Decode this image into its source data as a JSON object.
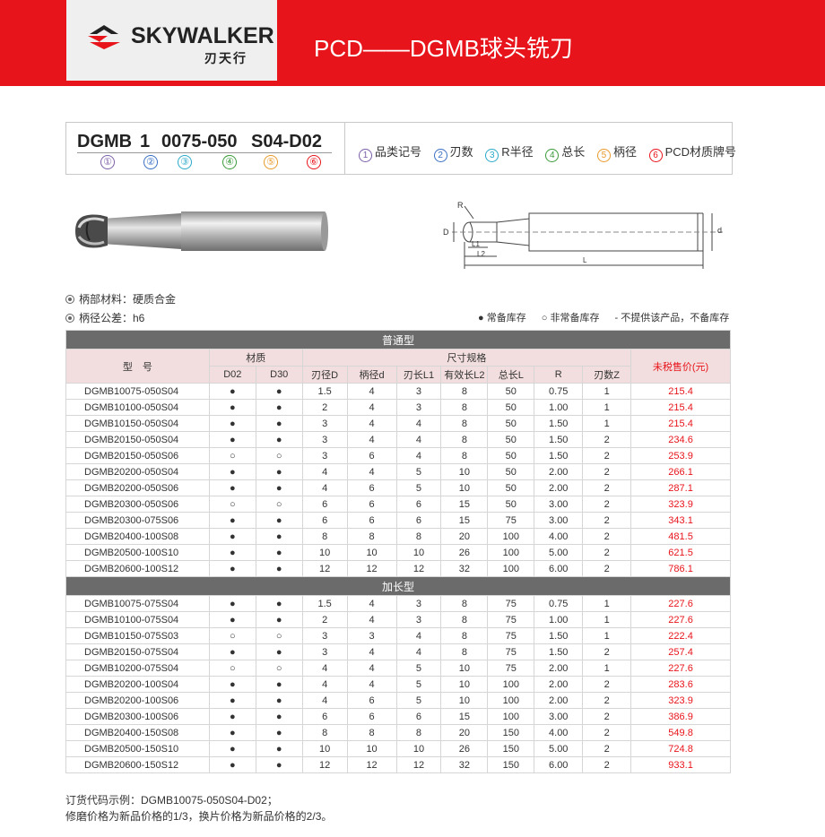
{
  "header": {
    "brand": "SKYWALKER",
    "brand_cn": "刃天行",
    "title": "PCD——DGMB球头铣刀",
    "colors": {
      "red": "#e8141b",
      "gray": "#6b6b6b",
      "pink": "#f2dede"
    }
  },
  "code": {
    "segments": [
      "DGMB",
      "1",
      "0075-050",
      "S04-D02"
    ],
    "nums": [
      "①",
      "②",
      "③",
      "④",
      "⑤",
      "⑥"
    ],
    "num_colors": [
      "#7b5ea7",
      "#3a6fc4",
      "#2aa9c9",
      "#3a9a3a",
      "#e89a2a",
      "#e8141b"
    ],
    "legend": [
      {
        "num": "1",
        "label": "品类记号"
      },
      {
        "num": "2",
        "label": "刃数"
      },
      {
        "num": "3",
        "label": "R半径"
      },
      {
        "num": "4",
        "label": "总长"
      },
      {
        "num": "5",
        "label": "柄径"
      },
      {
        "num": "6",
        "label": "PCD材质牌号"
      }
    ]
  },
  "diagram": {
    "labels": {
      "R": "R",
      "D": "D",
      "d": "d",
      "L1": "L1",
      "L2": "L2",
      "L": "L"
    }
  },
  "notes": {
    "material": "柄部材料：硬质合金",
    "tolerance": "柄径公差：h6",
    "stock": [
      "● 常备库存",
      "○ 非常备库存",
      "- 不提供该产品，不备库存"
    ]
  },
  "table": {
    "section1": "普通型",
    "section2": "加长型",
    "head": {
      "model": "型　号",
      "material": "材质",
      "size": "尺寸规格",
      "price": "未税售价(元)",
      "cols": [
        "D02",
        "D30",
        "刃径D",
        "柄径d",
        "刃长L1",
        "有效长L2",
        "总长L",
        "R",
        "刃数Z"
      ]
    },
    "rows_standard": [
      [
        "DGMB10075-050S04",
        "●",
        "●",
        "1.5",
        "4",
        "3",
        "8",
        "50",
        "0.75",
        "1",
        "215.4"
      ],
      [
        "DGMB10100-050S04",
        "●",
        "●",
        "2",
        "4",
        "3",
        "8",
        "50",
        "1.00",
        "1",
        "215.4"
      ],
      [
        "DGMB10150-050S04",
        "●",
        "●",
        "3",
        "4",
        "4",
        "8",
        "50",
        "1.50",
        "1",
        "215.4"
      ],
      [
        "DGMB20150-050S04",
        "●",
        "●",
        "3",
        "4",
        "4",
        "8",
        "50",
        "1.50",
        "2",
        "234.6"
      ],
      [
        "DGMB20150-050S06",
        "○",
        "○",
        "3",
        "6",
        "4",
        "8",
        "50",
        "1.50",
        "2",
        "253.9"
      ],
      [
        "DGMB20200-050S04",
        "●",
        "●",
        "4",
        "4",
        "5",
        "10",
        "50",
        "2.00",
        "2",
        "266.1"
      ],
      [
        "DGMB20200-050S06",
        "●",
        "●",
        "4",
        "6",
        "5",
        "10",
        "50",
        "2.00",
        "2",
        "287.1"
      ],
      [
        "DGMB20300-050S06",
        "○",
        "○",
        "6",
        "6",
        "6",
        "15",
        "50",
        "3.00",
        "2",
        "323.9"
      ],
      [
        "DGMB20300-075S06",
        "●",
        "●",
        "6",
        "6",
        "6",
        "15",
        "75",
        "3.00",
        "2",
        "343.1"
      ],
      [
        "DGMB20400-100S08",
        "●",
        "●",
        "8",
        "8",
        "8",
        "20",
        "100",
        "4.00",
        "2",
        "481.5"
      ],
      [
        "DGMB20500-100S10",
        "●",
        "●",
        "10",
        "10",
        "10",
        "26",
        "100",
        "5.00",
        "2",
        "621.5"
      ],
      [
        "DGMB20600-100S12",
        "●",
        "●",
        "12",
        "12",
        "12",
        "32",
        "100",
        "6.00",
        "2",
        "786.1"
      ]
    ],
    "rows_long": [
      [
        "DGMB10075-075S04",
        "●",
        "●",
        "1.5",
        "4",
        "3",
        "8",
        "75",
        "0.75",
        "1",
        "227.6"
      ],
      [
        "DGMB10100-075S04",
        "●",
        "●",
        "2",
        "4",
        "3",
        "8",
        "75",
        "1.00",
        "1",
        "227.6"
      ],
      [
        "DGMB10150-075S03",
        "○",
        "○",
        "3",
        "3",
        "4",
        "8",
        "75",
        "1.50",
        "1",
        "222.4"
      ],
      [
        "DGMB20150-075S04",
        "●",
        "●",
        "3",
        "4",
        "4",
        "8",
        "75",
        "1.50",
        "2",
        "257.4"
      ],
      [
        "DGMB10200-075S04",
        "○",
        "○",
        "4",
        "4",
        "5",
        "10",
        "75",
        "2.00",
        "1",
        "227.6"
      ],
      [
        "DGMB20200-100S04",
        "●",
        "●",
        "4",
        "4",
        "5",
        "10",
        "100",
        "2.00",
        "2",
        "283.6"
      ],
      [
        "DGMB20200-100S06",
        "●",
        "●",
        "4",
        "6",
        "5",
        "10",
        "100",
        "2.00",
        "2",
        "323.9"
      ],
      [
        "DGMB20300-100S06",
        "●",
        "●",
        "6",
        "6",
        "6",
        "15",
        "100",
        "3.00",
        "2",
        "386.9"
      ],
      [
        "DGMB20400-150S08",
        "●",
        "●",
        "8",
        "8",
        "8",
        "20",
        "150",
        "4.00",
        "2",
        "549.8"
      ],
      [
        "DGMB20500-150S10",
        "●",
        "●",
        "10",
        "10",
        "10",
        "26",
        "150",
        "5.00",
        "2",
        "724.8"
      ],
      [
        "DGMB20600-150S12",
        "●",
        "●",
        "12",
        "12",
        "12",
        "32",
        "150",
        "6.00",
        "2",
        "933.1"
      ]
    ]
  },
  "footer": {
    "line1": "订货代码示例：DGMB10075-050S04-D02；",
    "line2": "修磨价格为新品价格的1/3，换片价格为新品价格的2/3。"
  }
}
